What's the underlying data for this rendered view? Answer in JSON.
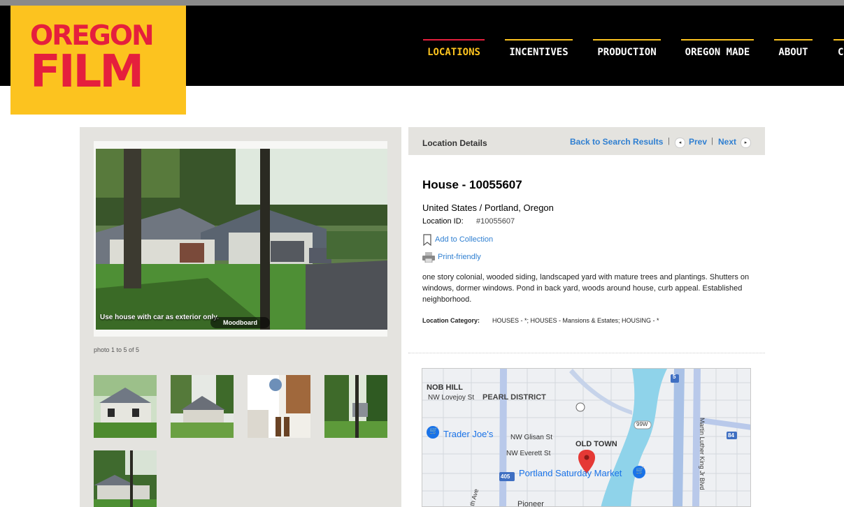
{
  "header": {
    "logo_line1": "OREGON",
    "logo_line2": "FILM",
    "nav": [
      "LOCATIONS",
      "INCENTIVES",
      "PRODUCTION",
      "OREGON MADE",
      "ABOUT",
      "C"
    ],
    "active_nav": "LOCATIONS"
  },
  "gallery": {
    "main_caption": "Use house with car as exterior only.",
    "moodboard_label": "Moodboard",
    "photo_count": "photo 1 to 5 of 5"
  },
  "details": {
    "bar_label": "Location Details",
    "back_link": "Back to Search Results",
    "prev_link": "Prev",
    "next_link": "Next",
    "separator": "|",
    "title": "House - 10055607",
    "location": "United States / Portland, Oregon",
    "id_label": "Location ID:",
    "id_value": "#10055607",
    "add_collection": "Add to Collection",
    "print_friendly": "Print-friendly",
    "description": "one story colonial, wooded siding, landscaped yard with mature trees and plantings. Shutters on windows, dormer windows. Pond in back yard, woods around house, curb appeal. Established neighborhood.",
    "category_label": "Location Category:",
    "category_value": "HOUSES - *; HOUSES - Mansions & Estates; HOUSING - *"
  },
  "map": {
    "labels": {
      "nob_hill": "NOB HILL",
      "lovejoy": "NW Lovejoy St",
      "pearl": "PEARL DISTRICT",
      "trader": "Trader Joe's",
      "glisan": "NW Glisan St",
      "old_town": "OLD TOWN",
      "everett": "NW Everett St",
      "saturday": "Portland Saturday Market",
      "mlk": "Martin Luther King Jr Blvd",
      "pioneer": "Pioneer",
      "ave": "th Ave",
      "r5": "5",
      "r84": "84",
      "r99w": "99W",
      "r405": "405"
    }
  },
  "colors": {
    "brand_yellow": "#fcc31f",
    "brand_red": "#e51f3d",
    "link_blue": "#2f7fd1",
    "panel_gray": "#e4e3df"
  }
}
